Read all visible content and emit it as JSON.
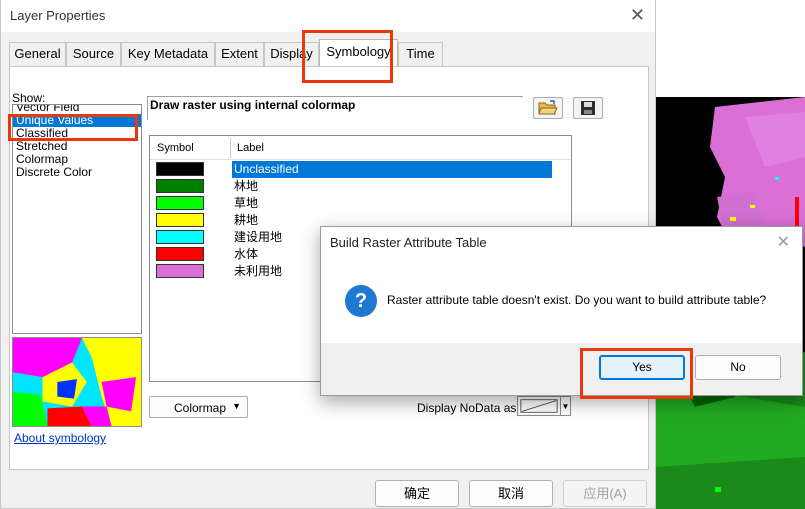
{
  "window": {
    "title": "Layer Properties",
    "close_glyph": "✕"
  },
  "tabs": [
    {
      "label": "General"
    },
    {
      "label": "Source"
    },
    {
      "label": "Key Metadata"
    },
    {
      "label": "Extent"
    },
    {
      "label": "Display"
    },
    {
      "label": "Symbology",
      "active": true
    },
    {
      "label": "Time"
    }
  ],
  "show": {
    "label": "Show:",
    "items": [
      "Vector Field",
      "Unique Values",
      "Classified",
      "Stretched",
      "Colormap",
      "Discrete Color"
    ],
    "selected": "Unique Values"
  },
  "about_link": "About symbology",
  "description": "Draw raster using internal colormap",
  "icons": {
    "open": "folder-open-icon",
    "save": "floppy-disk-icon"
  },
  "table": {
    "col_symbol": "Symbol",
    "col_label": "Label",
    "rows": [
      {
        "label": "Unclassified",
        "color": "",
        "selected": true
      },
      {
        "label": "林地",
        "color": "#008000"
      },
      {
        "label": "草地",
        "color": "#00ff00"
      },
      {
        "label": "耕地",
        "color": "#ffff00"
      },
      {
        "label": "建设用地",
        "color": "#00ffff"
      },
      {
        "label": "水体",
        "color": "#ff0000"
      },
      {
        "label": "未利用地",
        "color": "#da70d6"
      }
    ],
    "first_swatch_color": "#000000"
  },
  "colormap_button": "Colormap",
  "nodata_label": "Display NoData as",
  "footer": {
    "ok": "确定",
    "cancel": "取消",
    "apply": "应用(A)"
  },
  "dialog": {
    "title": "Build Raster Attribute Table",
    "close_glyph": "✕",
    "icon": "question-icon",
    "message": "Raster attribute table doesn't exist. Do you want to build attribute table?",
    "yes": "Yes",
    "no": "No"
  },
  "colors": {
    "selection": "#0078d7",
    "highlight": "#e8380d"
  }
}
